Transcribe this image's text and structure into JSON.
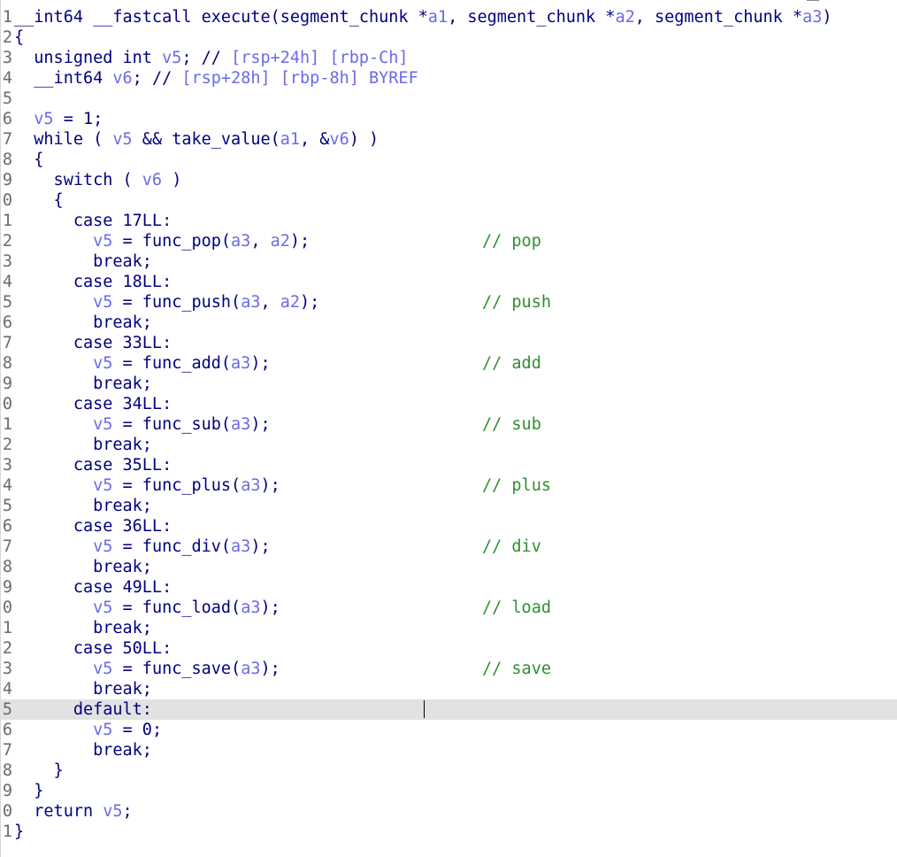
{
  "editor": {
    "lines": [
      {
        "num": "1",
        "text": "__int64 __fastcall execute(segment_chunk *a1, segment_chunk *a2, segment_chunk *a3)",
        "comment": ""
      },
      {
        "num": "2",
        "text": "{",
        "comment": ""
      },
      {
        "num": "3",
        "text": "  unsigned int v5; // [rsp+24h] [rbp-Ch]",
        "comment": ""
      },
      {
        "num": "4",
        "text": "  __int64 v6; // [rsp+28h] [rbp-8h] BYREF",
        "comment": ""
      },
      {
        "num": "5",
        "text": "",
        "comment": ""
      },
      {
        "num": "6",
        "text": "  v5 = 1;",
        "comment": ""
      },
      {
        "num": "7",
        "text": "  while ( v5 && take_value(a1, &v6) )",
        "comment": ""
      },
      {
        "num": "8",
        "text": "  {",
        "comment": ""
      },
      {
        "num": "9",
        "text": "    switch ( v6 )",
        "comment": ""
      },
      {
        "num": "0",
        "text": "    {",
        "comment": ""
      },
      {
        "num": "1",
        "text": "      case 17LL:",
        "comment": ""
      },
      {
        "num": "2",
        "text": "        v5 = func_pop(a3, a2);",
        "comment": "// pop"
      },
      {
        "num": "3",
        "text": "        break;",
        "comment": ""
      },
      {
        "num": "4",
        "text": "      case 18LL:",
        "comment": ""
      },
      {
        "num": "5",
        "text": "        v5 = func_push(a3, a2);",
        "comment": "// push"
      },
      {
        "num": "6",
        "text": "        break;",
        "comment": ""
      },
      {
        "num": "7",
        "text": "      case 33LL:",
        "comment": ""
      },
      {
        "num": "8",
        "text": "        v5 = func_add(a3);",
        "comment": "// add"
      },
      {
        "num": "9",
        "text": "        break;",
        "comment": ""
      },
      {
        "num": "0",
        "text": "      case 34LL:",
        "comment": ""
      },
      {
        "num": "1",
        "text": "        v5 = func_sub(a3);",
        "comment": "// sub"
      },
      {
        "num": "2",
        "text": "        break;",
        "comment": ""
      },
      {
        "num": "3",
        "text": "      case 35LL:",
        "comment": ""
      },
      {
        "num": "4",
        "text": "        v5 = func_plus(a3);",
        "comment": "// plus"
      },
      {
        "num": "5",
        "text": "        break;",
        "comment": ""
      },
      {
        "num": "6",
        "text": "      case 36LL:",
        "comment": ""
      },
      {
        "num": "7",
        "text": "        v5 = func_div(a3);",
        "comment": "// div"
      },
      {
        "num": "8",
        "text": "        break;",
        "comment": ""
      },
      {
        "num": "9",
        "text": "      case 49LL:",
        "comment": ""
      },
      {
        "num": "0",
        "text": "        v5 = func_load(a3);",
        "comment": "// load"
      },
      {
        "num": "1",
        "text": "        break;",
        "comment": ""
      },
      {
        "num": "2",
        "text": "      case 50LL:",
        "comment": ""
      },
      {
        "num": "3",
        "text": "        v5 = func_save(a3);",
        "comment": "// save"
      },
      {
        "num": "4",
        "text": "        break;",
        "comment": ""
      },
      {
        "num": "5",
        "text": "      default:",
        "comment": "",
        "highlight": true
      },
      {
        "num": "6",
        "text": "        v5 = 0;",
        "comment": ""
      },
      {
        "num": "7",
        "text": "        break;",
        "comment": ""
      },
      {
        "num": "8",
        "text": "    }",
        "comment": ""
      },
      {
        "num": "9",
        "text": "  }",
        "comment": ""
      },
      {
        "num": "0",
        "text": "  return v5;",
        "comment": ""
      },
      {
        "num": "1",
        "text": "}",
        "comment": ""
      }
    ]
  },
  "colors": {
    "keyword": "#000080",
    "variable": "#6a6ae8",
    "comment": "#2f8f2f",
    "line_number": "#6a6a6a",
    "highlight": "#e2e2e2"
  }
}
